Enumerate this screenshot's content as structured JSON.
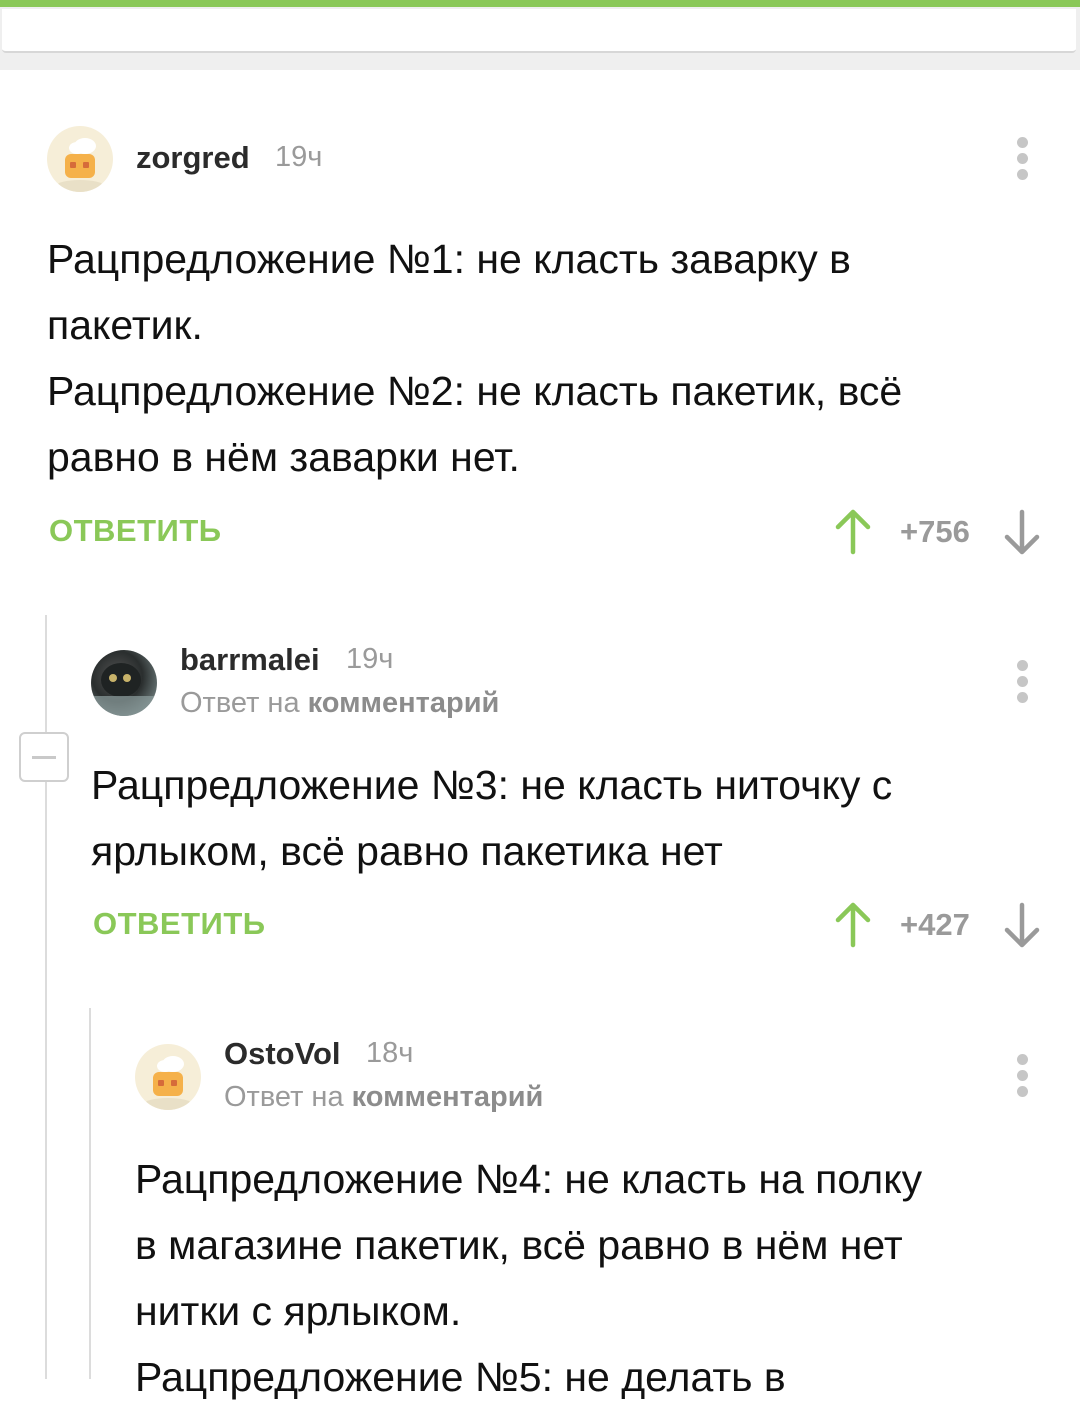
{
  "comments": [
    {
      "username": "zorgred",
      "time": "19ч",
      "text": "Рацпредложение №1: не класть заварку в\nпакетик.\nРацпредложение №2: не класть пакетик, всё\nравно в нём заварки нет.",
      "reply_label": "ОТВЕТИТЬ",
      "score": "+756",
      "avatar": "default-avatar-icon"
    },
    {
      "username": "barrmalei",
      "time": "19ч",
      "reply_prefix": "Ответ на",
      "reply_link": "комментарий",
      "text": "Рацпредложение №3: не класть ниточку с\nярлыком, всё равно пакетика нет",
      "reply_label": "ОТВЕТИТЬ",
      "score": "+427",
      "avatar": "user-photo-avatar"
    },
    {
      "username": "OstoVol",
      "time": "18ч",
      "reply_prefix": "Ответ на",
      "reply_link": "комментарий",
      "text": "Рацпредложение №4: не класть на полку\nв магазине пакетик, всё равно в нём нет\nнитки с ярлыком.\nРацпредложение №5: не делать в",
      "avatar": "default-avatar-icon"
    }
  ],
  "colors": {
    "accent": "#8ac858",
    "muted": "#9a9a9a"
  }
}
